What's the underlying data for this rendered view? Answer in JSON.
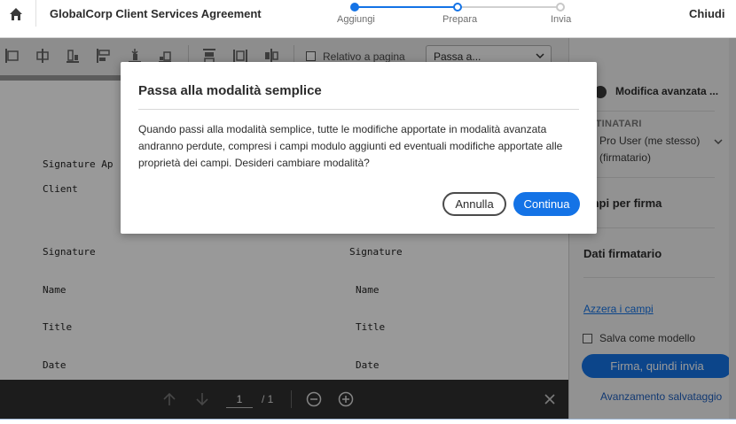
{
  "header": {
    "title": "GlobalCorp Client Services Agreement",
    "close_label": "Chiudi",
    "steps": [
      {
        "label": "Aggiungi",
        "state": "done"
      },
      {
        "label": "Prepara",
        "state": "current"
      },
      {
        "label": "Invia",
        "state": "pending"
      }
    ]
  },
  "toolbar": {
    "relative_label": "Relativo a pagina",
    "goto_value": "Passa a..."
  },
  "document": {
    "lines": {
      "sig_approval": "Signature Ap",
      "client": "Client",
      "signature_left": "Signature",
      "signature_right": "Signature",
      "name_left": "Name",
      "name_right": "Name",
      "title_left": "Title",
      "title_right": "Title",
      "date_left": "Date",
      "date_right": "Date"
    }
  },
  "nav": {
    "page_current": "1",
    "page_total": "/ 1"
  },
  "panel": {
    "advanced_label": "Modifica avanzata ...",
    "recipients_heading": "STINATARI",
    "recipient_name": "Pro User (me stesso)",
    "recipient_role": "(firmatario)",
    "fields_heading": "mpi per firma",
    "signer_data_heading": "Dati firmatario",
    "reset_fields": "Azzera i campi",
    "save_template": "Salva come modello",
    "sign_button": "Firma, quindi invia",
    "save_progress": "Avanzamento salvataggio"
  },
  "modal": {
    "title": "Passa alla modalità semplice",
    "body": "Quando passi alla modalità semplice, tutte le modifiche apportate in modalità avanzata andranno perdute, compresi i campi modulo aggiunti ed eventuali modifiche apportate alle proprietà dei campi. Desideri cambiare modalità?",
    "cancel_label": "Annulla",
    "continue_label": "Continua"
  },
  "colors": {
    "accent": "#1473e6",
    "overlay": "rgba(0,0,0,0.40)",
    "navbar": "#2f2f2f"
  },
  "icons": [
    "home-icon",
    "align-left-icon",
    "align-center-icon",
    "align-right-icon",
    "align-top-icon",
    "align-middle-icon",
    "align-bottom-icon",
    "distribute-horizontal-icon",
    "distribute-vertical-icon",
    "match-size-icon",
    "chevron-down-icon",
    "arrow-up-icon",
    "arrow-down-icon",
    "zoom-out-icon",
    "zoom-in-icon",
    "close-icon"
  ]
}
